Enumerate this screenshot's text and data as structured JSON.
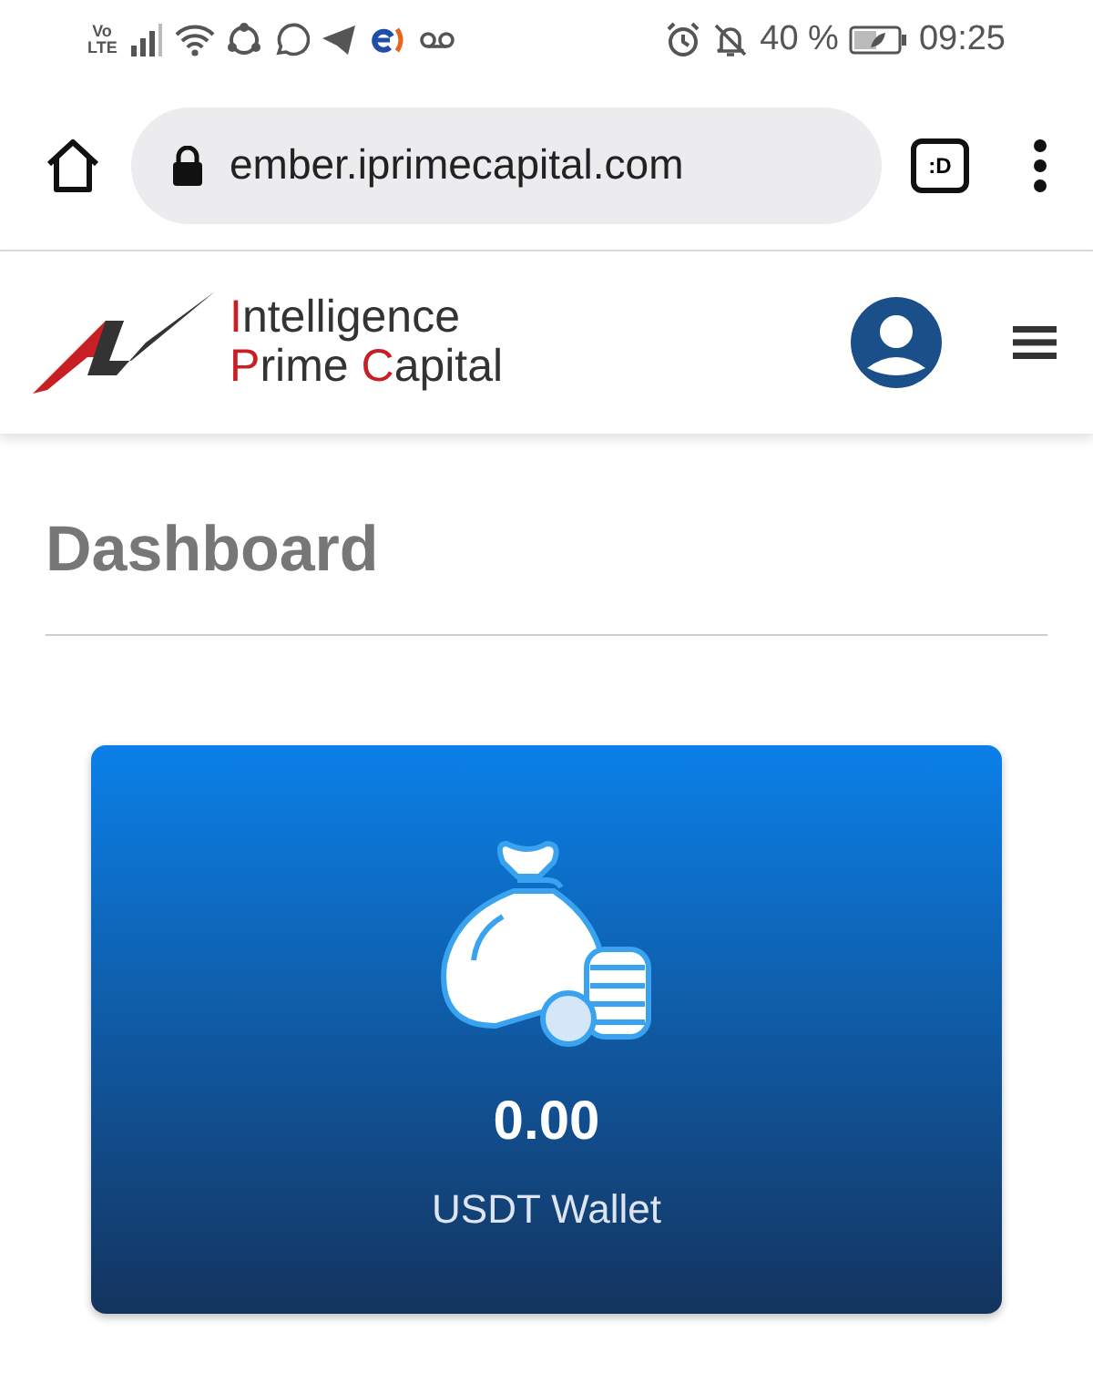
{
  "status_bar": {
    "network": "Vo LTE",
    "battery": "40 %",
    "time": "09:25"
  },
  "browser": {
    "url": "ember.iprimecapital.com",
    "tab_count": ":D"
  },
  "header": {
    "logo_lines": [
      [
        {
          "text": "I",
          "accent": true
        },
        {
          "text": "ntelligence",
          "accent": false
        }
      ],
      [
        {
          "text": "P",
          "accent": true
        },
        {
          "text": "rime ",
          "accent": false
        },
        {
          "text": "C",
          "accent": true
        },
        {
          "text": "apital",
          "accent": false
        }
      ]
    ]
  },
  "page": {
    "title": "Dashboard"
  },
  "wallet_card": {
    "amount": "0.00",
    "label": "USDT Wallet"
  }
}
